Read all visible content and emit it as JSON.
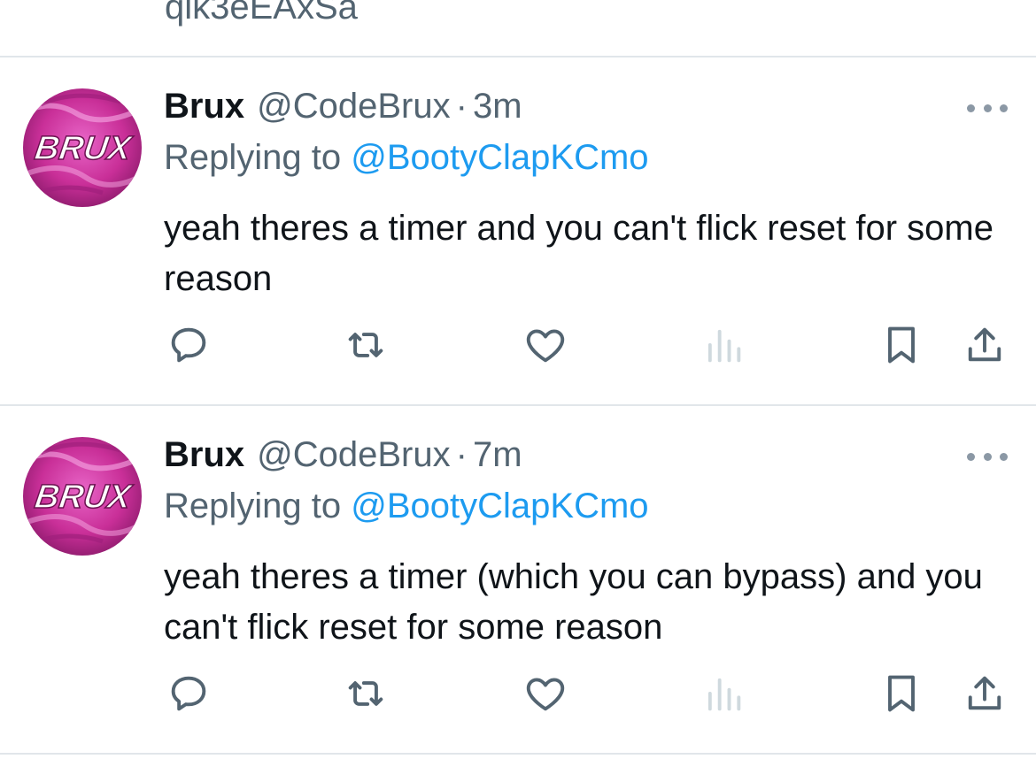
{
  "previous_tweet": {
    "tail_text": "qik3eEAxSa"
  },
  "tweets": [
    {
      "avatar_text": "BRUX",
      "name": "Brux",
      "handle": "@CodeBrux",
      "separator": "·",
      "time": "3m",
      "replying_prefix": "Replying to ",
      "replying_to": "@BootyClapKCmo",
      "text": "yeah theres a timer and you can't flick reset for some reason"
    },
    {
      "avatar_text": "BRUX",
      "name": "Brux",
      "handle": "@CodeBrux",
      "separator": "·",
      "time": "7m",
      "replying_prefix": "Replying to ",
      "replying_to": "@BootyClapKCmo",
      "text": "yeah theres a timer (which you can bypass) and you can't flick reset for some reason"
    }
  ],
  "icons": {
    "reply": "reply-icon",
    "retweet": "retweet-icon",
    "like": "heart-icon",
    "views": "views-icon",
    "bookmark": "bookmark-icon",
    "share": "share-icon",
    "more": "more-icon"
  },
  "colors": {
    "text": "#0f1419",
    "secondary": "#536471",
    "link": "#1d9bf0",
    "icon": "#536471",
    "divider": "#e1e6ea",
    "avatar_pink": "#d63aa7"
  }
}
